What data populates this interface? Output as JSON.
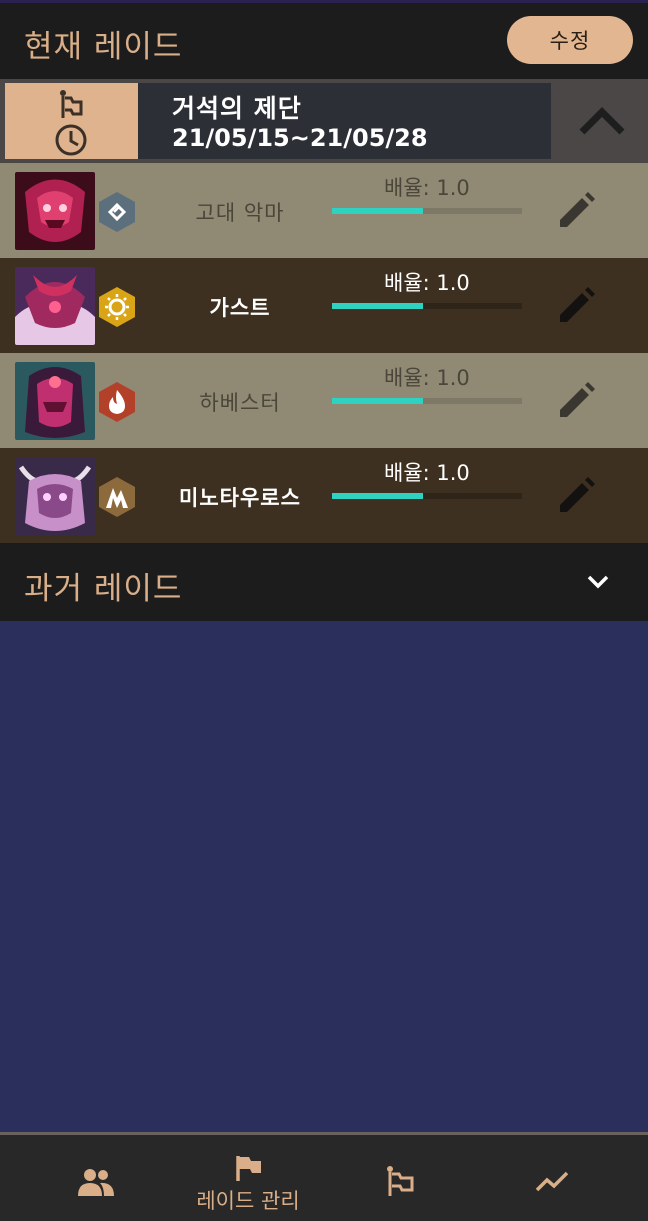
{
  "header": {
    "title": "현재 레이드",
    "edit_label": "수정"
  },
  "raid": {
    "name": "거석의 제단",
    "dates": "21/05/15~21/05/28"
  },
  "bosses": [
    {
      "name": "고대 악마",
      "multiplier_label": "배율: 1.0",
      "progress": 0.48,
      "element": "wind",
      "element_color": "#5b6f7d"
    },
    {
      "name": "가스트",
      "multiplier_label": "배율: 1.0",
      "progress": 0.48,
      "element": "light",
      "element_color": "#d9a516"
    },
    {
      "name": "하베스터",
      "multiplier_label": "배율: 1.0",
      "progress": 0.48,
      "element": "fire",
      "element_color": "#b3412a"
    },
    {
      "name": "미노타우로스",
      "multiplier_label": "배율: 1.0",
      "progress": 0.48,
      "element": "earth",
      "element_color": "#8c6a3c"
    }
  ],
  "past": {
    "title": "과거 레이드"
  },
  "nav": {
    "items": [
      {
        "icon": "people-icon",
        "label": ""
      },
      {
        "icon": "flag-icon",
        "label": "레이드 관리"
      },
      {
        "icon": "raid-flag-icon",
        "label": ""
      },
      {
        "icon": "trend-icon",
        "label": ""
      }
    ]
  },
  "colors": {
    "accent": "#e2b690",
    "progress": "#2fd2c1",
    "background": "#2b2f5c"
  }
}
